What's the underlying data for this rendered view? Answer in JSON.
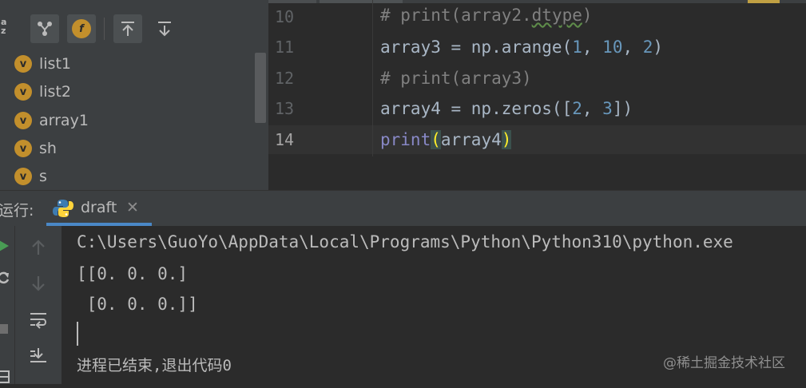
{
  "structure": {
    "toolbar": [
      "sort-alpha-icon",
      "show-inherited-icon",
      "show-fields-icon",
      "expand-all-icon",
      "collapse-all-icon"
    ],
    "sort_label": "a\nz",
    "fields_badge": "f",
    "items": [
      {
        "label": "list1",
        "badge": "v"
      },
      {
        "label": "list2",
        "badge": "v"
      },
      {
        "label": "array1",
        "badge": "v"
      },
      {
        "label": "sh",
        "badge": "v"
      },
      {
        "label": "s",
        "badge": "v"
      }
    ]
  },
  "editor": {
    "lines": [
      {
        "num": "10",
        "text": "# print(array2.dtype)"
      },
      {
        "num": "11",
        "text": "array3 = np.arange(1, 10, 2)"
      },
      {
        "num": "12",
        "text": "# print(array3)"
      },
      {
        "num": "13",
        "text": "array4 = np.zeros([2, 3])"
      },
      {
        "num": "14",
        "text": "print(array4)"
      }
    ],
    "code": {
      "l10_hash": "# print(array2.",
      "l10_dtype": "dtype",
      "l10_close": ")",
      "l11_a": "array3 = np.arange(",
      "l11_n1": "1",
      "l11_c1": ", ",
      "l11_n2": "10",
      "l11_c2": ", ",
      "l11_n3": "2",
      "l11_end": ")",
      "l12": "# print(array3)",
      "l13_a": "array4 = np.zeros([",
      "l13_n1": "2",
      "l13_c": ", ",
      "l13_n2": "3",
      "l13_end": "])",
      "l14_kw": "print",
      "l14_open": "(",
      "l14_arg": "array4",
      "l14_close": ")"
    }
  },
  "run": {
    "label": "运行:",
    "tab_label": "draft",
    "tab_close": "✕",
    "left_toolbar": [
      "run-icon",
      "rerun-icon",
      "stop-icon",
      "layout-icon"
    ],
    "console_toolbar": [
      "up-arrow-icon",
      "down-arrow-icon",
      "soft-wrap-icon",
      "scroll-to-end-icon"
    ],
    "output": [
      "C:\\Users\\GuoYo\\AppData\\Local\\Programs\\Python\\Python310\\python.exe",
      "[[0. 0. 0.]",
      " [0. 0. 0.]]",
      "",
      "进程已结束,退出代码0"
    ]
  },
  "watermark": "@稀土掘金技术社区",
  "colors": {
    "background": "#2b2b2b",
    "panel": "#3c3f41",
    "comment": "#808080",
    "number": "#6897bb",
    "builtin": "#8888c6",
    "bracket_match": "#ffef28",
    "var_badge": "#c28f2c",
    "tab_accent": "#4a88c7"
  }
}
